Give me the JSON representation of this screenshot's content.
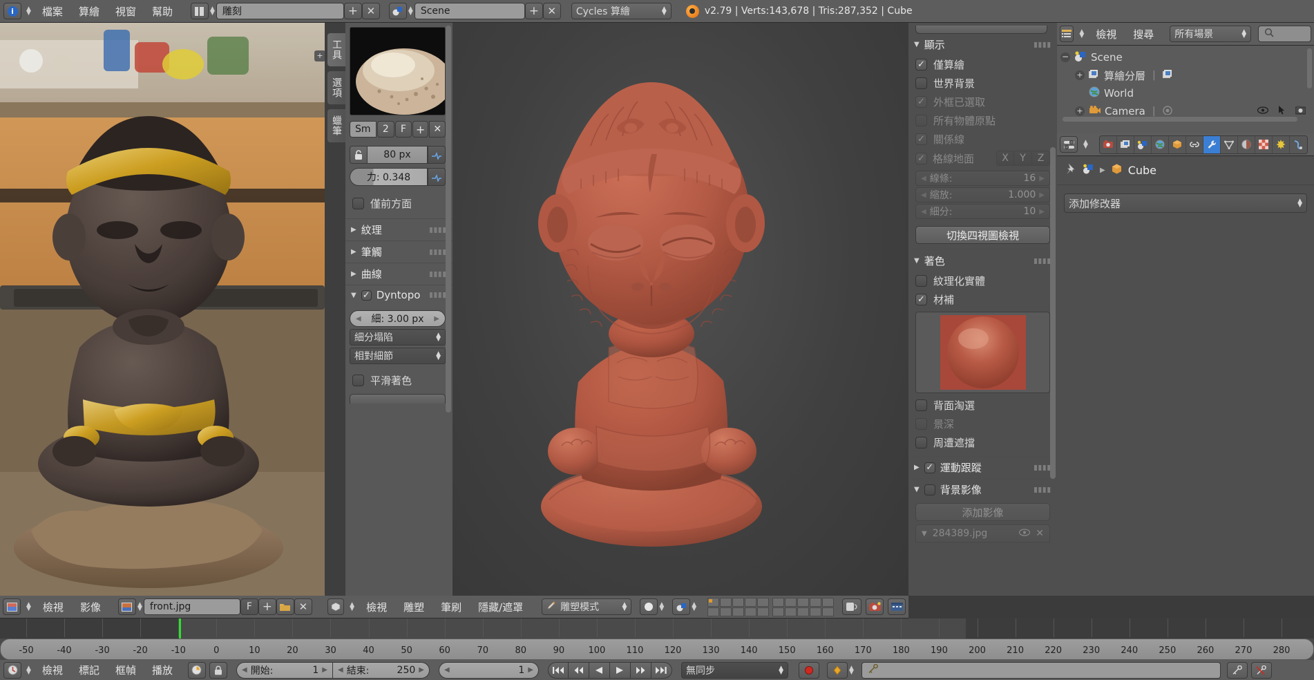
{
  "topbar": {
    "editor_icon": "info-editor-icon",
    "menus": [
      "檔案",
      "算繪",
      "視窗",
      "幫助"
    ],
    "screen_layout_icon": "screen-layout-icon",
    "screen_layout": "雕刻",
    "add_label": "+",
    "close_label": "✕",
    "scene_icon": "scene-icon",
    "scene_name": "Scene",
    "engine": "Cycles 算繪",
    "blender_icon": "blender-logo-icon",
    "status": "v2.79 | Verts:143,678 | Tris:287,352 | Cube"
  },
  "image_editor": {
    "editor_icon": "image-editor-icon",
    "menus": [
      "檢視",
      "影像"
    ],
    "datablock_icon": "image-datablock-icon",
    "image_name": "front.jpg",
    "fake_user": "F",
    "new_label": "+",
    "open_icon": "folder-open-icon",
    "unlink_label": "✕"
  },
  "toolshelf": {
    "tabs": [
      "工具",
      "選項",
      "蠟筆"
    ],
    "active_tab": "工具",
    "brush_preview": "brush-preview-thumbnail",
    "brush_name": "Sm",
    "brush_users": "2",
    "brush_fake_user": "F",
    "brush_new": "+",
    "brush_unlink": "✕",
    "radius_lock_icon": "unlock-icon",
    "radius_value": "80 px",
    "radius_pressure_icon": "pressure-icon",
    "strength_value": "力: 0.348",
    "strength_pressure_icon": "pressure-icon",
    "front_faces_only": "僅前方面",
    "panels": [
      "紋理",
      "筆觸",
      "曲線"
    ],
    "dyntopo": {
      "label": "Dyntopo",
      "enabled": true,
      "detail_size": "細:  3.00 px",
      "mode": "細分塌陷",
      "refine_method": "相對細節"
    },
    "smooth_shading": "平滑著色"
  },
  "viewport": {
    "editor_icon": "view3d-editor-icon",
    "menus": [
      "檢視",
      "雕塑",
      "筆刷",
      "隱藏/遮罩"
    ],
    "mode_icon": "sculpt-mode-icon",
    "mode": "雕塑模式",
    "shading_icon": "solid-shading-icon",
    "pivot_icon": "pivot-icon",
    "layers_icon": "scene-layers-icon",
    "lock_icon": "lock-camera-icon",
    "render_icon": "render-image-icon",
    "render_anim_icon": "render-animation-icon"
  },
  "properties_panel": {
    "display": {
      "title": "顯示",
      "items": [
        {
          "label": "僅算繪",
          "checked": true,
          "dimmed": false
        },
        {
          "label": "世界背景",
          "checked": false,
          "dimmed": false
        },
        {
          "label": "外框已選取",
          "checked": true,
          "dimmed": true
        },
        {
          "label": "所有物體原點",
          "checked": false,
          "dimmed": true
        },
        {
          "label": "關係線",
          "checked": true,
          "dimmed": true
        }
      ],
      "floor_grid": {
        "label": "格線地面",
        "checked": true,
        "axes": [
          "X",
          "Y",
          "Z"
        ]
      },
      "numbers": [
        {
          "label": "線條:",
          "value": "16"
        },
        {
          "label": "縮放:",
          "value": "1.000"
        },
        {
          "label": "細分:",
          "value": "10"
        }
      ],
      "quadview_button": "切換四視圖檢視"
    },
    "shading": {
      "title": "著色",
      "items": [
        {
          "label": "紋理化實體",
          "checked": false,
          "dimmed": false
        },
        {
          "label": "材補",
          "checked": true,
          "dimmed": false
        }
      ],
      "matcap_preview": "matcap-sphere-preview",
      "items2": [
        {
          "label": "背面淘選",
          "checked": false,
          "dimmed": false
        },
        {
          "label": "景深",
          "checked": false,
          "dimmed": true
        },
        {
          "label": "周遭遮擋",
          "checked": false,
          "dimmed": false
        }
      ]
    },
    "motion_tracking": {
      "title": "運動跟蹤",
      "checked": true
    },
    "background_images": {
      "title": "背景影像",
      "checked": false,
      "add_button": "添加影像",
      "image_entry": "284389.jpg",
      "visibility_icon": "eye-icon",
      "remove_icon": "close-icon"
    }
  },
  "outliner": {
    "editor_icon": "outliner-editor-icon",
    "menus": [
      "檢視",
      "搜尋"
    ],
    "display_mode": "所有場景",
    "search_icon": "search-icon",
    "tree": [
      {
        "label": "Scene",
        "icon": "scene-icon",
        "indent": 0,
        "expander": "minus"
      },
      {
        "label": "算繪分層",
        "icon": "renderlayers-icon",
        "indent": 1,
        "expander": "plus"
      },
      {
        "label": "World",
        "icon": "world-icon",
        "indent": 1,
        "expander": "none"
      },
      {
        "label": "Camera",
        "icon": "camera-icon",
        "indent": 1,
        "expander": "plus"
      }
    ]
  },
  "properties_editor": {
    "editor_icon": "properties-editor-icon",
    "tabs": [
      "render-tab-icon",
      "renderlayers-tab-icon",
      "scene-tab-icon",
      "world-tab-icon",
      "object-tab-icon",
      "constraints-tab-icon",
      "modifiers-tab-icon",
      "data-tab-icon",
      "material-tab-icon",
      "texture-tab-icon",
      "particles-tab-icon",
      "physics-tab-icon"
    ],
    "active_tab_index": 6,
    "pin_icon": "pin-icon",
    "breadcrumb_icon": "object-icon",
    "breadcrumb": "Cube",
    "add_modifier": "添加修改器"
  },
  "timeline": {
    "ticks": [
      "-50",
      "-40",
      "-30",
      "-20",
      "-10",
      "0",
      "10",
      "20",
      "30",
      "40",
      "50",
      "60",
      "70",
      "80",
      "90",
      "100",
      "110",
      "120",
      "130",
      "140",
      "150",
      "160",
      "170",
      "180",
      "190",
      "200",
      "210",
      "220",
      "230",
      "240",
      "250",
      "260",
      "270",
      "280"
    ],
    "current_frame_marker": 0
  },
  "playbar": {
    "editor_icon": "timeline-editor-icon",
    "menus": [
      "檢視",
      "標記",
      "框幀",
      "播放"
    ],
    "autokey_icon": "autokey-icon",
    "lock_icon": "lock-icon",
    "start_label": "開始:",
    "start_value": "1",
    "end_label": "結束:",
    "end_value": "250",
    "current_value": "1",
    "transport": [
      "jump-start-icon",
      "prev-keyframe-icon",
      "play-reverse-icon",
      "play-icon",
      "next-keyframe-icon",
      "jump-end-icon"
    ],
    "sync_mode": "無同步",
    "record_icon": "record-icon",
    "keyingset_icon": "keyingset-icon",
    "keyingset_field": "",
    "insert_key_icon": "insert-keyframe-icon",
    "delete_key_icon": "delete-keyframe-icon"
  },
  "colors": {
    "header_bg": "#5d5d5d",
    "panel_bg": "#4f4f4f",
    "viewport_bg": "#454545",
    "sculpt_clay": "#b35a45",
    "accent_blue": "#3b7fd4",
    "frame_marker_green": "#2ee02e",
    "record_red": "#cc2a21",
    "keyingset_yellow": "#e8a62b"
  }
}
